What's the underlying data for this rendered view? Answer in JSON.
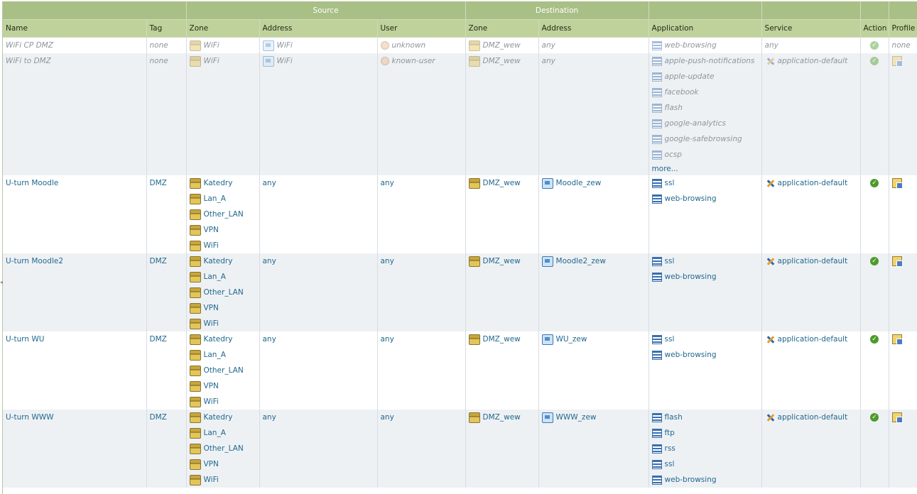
{
  "headers": {
    "group_source": "Source",
    "group_destination": "Destination",
    "name": "Name",
    "tag": "Tag",
    "src_zone": "Zone",
    "src_address": "Address",
    "user": "User",
    "dst_zone": "Zone",
    "dst_address": "Address",
    "application": "Application",
    "service": "Service",
    "action": "Action",
    "profile": "Profile"
  },
  "icons": {
    "zone": "zone-icon",
    "address": "address-object-icon",
    "user": "user-icon",
    "application": "application-icon",
    "service": "service-icon",
    "action_allow": "allow-check-icon",
    "profile": "security-profile-icon"
  },
  "colors": {
    "header_bg": "#a8bf86",
    "header_col_bg": "#bfd29c",
    "link": "#21688e",
    "disabled_text": "#8e959b",
    "allow_green": "#4e9a2a"
  },
  "rules": [
    {
      "name": "WiFi CP DMZ",
      "tag": "none",
      "disabled": true,
      "src_zones": [
        "WiFi"
      ],
      "src_addresses": [
        "WiFi"
      ],
      "users": [
        "unknown"
      ],
      "dst_zones": [
        "DMZ_wew"
      ],
      "dst_address_text": "any",
      "applications": [
        "web-browsing"
      ],
      "more": "",
      "service_text": "any",
      "service_icon": false,
      "action": "allow",
      "profile_text": "none",
      "profile_icon": false
    },
    {
      "name": "WiFi to DMZ",
      "tag": "none",
      "disabled": true,
      "src_zones": [
        "WiFi"
      ],
      "src_addresses": [
        "WiFi"
      ],
      "users": [
        "known-user"
      ],
      "dst_zones": [
        "DMZ_wew"
      ],
      "dst_address_text": "any",
      "applications": [
        "apple-push-notifications",
        "apple-update",
        "facebook",
        "flash",
        "google-analytics",
        "google-safebrowsing",
        "ocsp"
      ],
      "more": "more...",
      "service_text": "application-default",
      "service_icon": true,
      "action": "allow",
      "profile_text": "",
      "profile_icon": true
    },
    {
      "name": "U-turn Moodle",
      "tag": "DMZ",
      "disabled": false,
      "src_zones": [
        "Katedry",
        "Lan_A",
        "Other_LAN",
        "VPN",
        "WiFi"
      ],
      "src_address_text": "any",
      "user_text": "any",
      "dst_zones": [
        "DMZ_wew"
      ],
      "dst_addresses": [
        "Moodle_zew"
      ],
      "applications": [
        "ssl",
        "web-browsing"
      ],
      "more": "",
      "service_text": "application-default",
      "service_icon": true,
      "action": "allow",
      "profile_text": "",
      "profile_icon": true
    },
    {
      "name": "U-turn Moodle2",
      "tag": "DMZ",
      "disabled": false,
      "src_zones": [
        "Katedry",
        "Lan_A",
        "Other_LAN",
        "VPN",
        "WiFi"
      ],
      "src_address_text": "any",
      "user_text": "any",
      "dst_zones": [
        "DMZ_wew"
      ],
      "dst_addresses": [
        "Moodle2_zew"
      ],
      "applications": [
        "ssl",
        "web-browsing"
      ],
      "more": "",
      "service_text": "application-default",
      "service_icon": true,
      "action": "allow",
      "profile_text": "",
      "profile_icon": true
    },
    {
      "name": "U-turn WU",
      "tag": "DMZ",
      "disabled": false,
      "src_zones": [
        "Katedry",
        "Lan_A",
        "Other_LAN",
        "VPN",
        "WiFi"
      ],
      "src_address_text": "any",
      "user_text": "any",
      "dst_zones": [
        "DMZ_wew"
      ],
      "dst_addresses": [
        "WU_zew"
      ],
      "applications": [
        "ssl",
        "web-browsing"
      ],
      "more": "",
      "service_text": "application-default",
      "service_icon": true,
      "action": "allow",
      "profile_text": "",
      "profile_icon": true
    },
    {
      "name": "U-turn WWW",
      "tag": "DMZ",
      "disabled": false,
      "src_zones": [
        "Katedry",
        "Lan_A",
        "Other_LAN",
        "VPN",
        "WiFi"
      ],
      "src_address_text": "any",
      "user_text": "any",
      "dst_zones": [
        "DMZ_wew"
      ],
      "dst_addresses": [
        "WWW_zew"
      ],
      "applications": [
        "flash",
        "ftp",
        "rss",
        "ssl",
        "web-browsing"
      ],
      "more": "",
      "service_text": "application-default",
      "service_icon": true,
      "action": "allow",
      "profile_text": "",
      "profile_icon": true
    }
  ]
}
